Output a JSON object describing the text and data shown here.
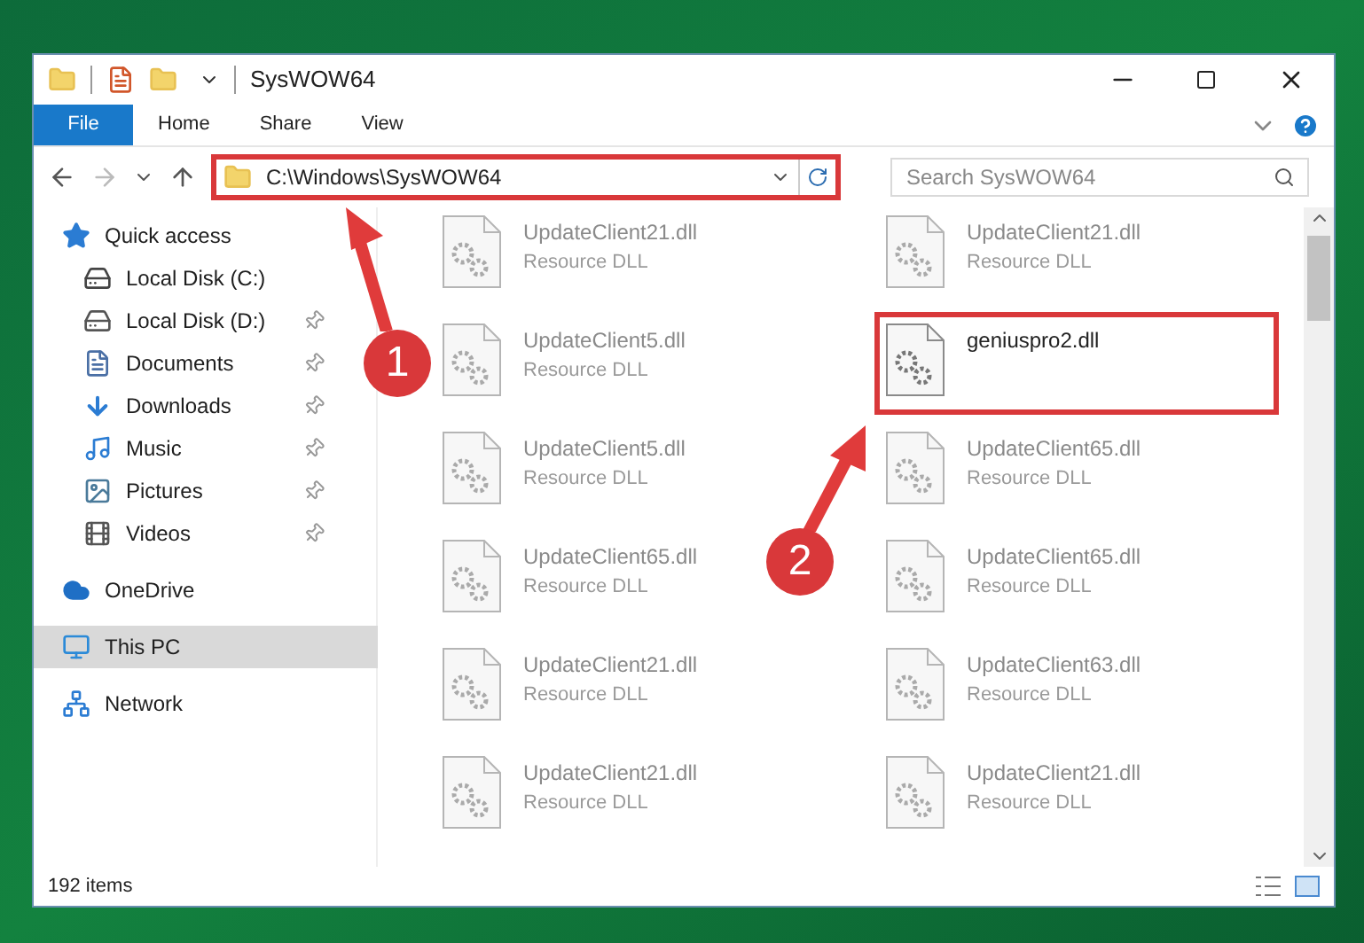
{
  "window": {
    "title": "SysWOW64"
  },
  "ribbon_tabs": [
    {
      "label": "File",
      "selected": true
    },
    {
      "label": "Home",
      "selected": false
    },
    {
      "label": "Share",
      "selected": false
    },
    {
      "label": "View",
      "selected": false
    }
  ],
  "address": {
    "path": "C:\\Windows\\SysWOW64",
    "highlighted": true
  },
  "search": {
    "placeholder": "Search SysWOW64"
  },
  "sidebar": {
    "items": [
      {
        "label": "Quick access",
        "kind": "quick",
        "selected": false,
        "pinned": false,
        "children": [
          {
            "label": "Local Disk (C:)",
            "kind": "disk-c",
            "selected": false,
            "pinned": false
          },
          {
            "label": "Local Disk (D:)",
            "kind": "disk",
            "selected": false,
            "pinned": true
          },
          {
            "label": "Documents",
            "kind": "documents",
            "selected": false,
            "pinned": true
          },
          {
            "label": "Downloads",
            "kind": "downloads",
            "selected": false,
            "pinned": true
          },
          {
            "label": "Music",
            "kind": "music",
            "selected": false,
            "pinned": true
          },
          {
            "label": "Pictures",
            "kind": "pictures",
            "selected": false,
            "pinned": true
          },
          {
            "label": "Videos",
            "kind": "videos",
            "selected": false,
            "pinned": true
          }
        ]
      },
      {
        "label": "OneDrive",
        "kind": "onedrive",
        "selected": false,
        "pinned": false
      },
      {
        "label": "This PC",
        "kind": "pc",
        "selected": true,
        "pinned": false
      },
      {
        "label": "Network",
        "kind": "network",
        "selected": false,
        "pinned": false
      }
    ]
  },
  "files": [
    {
      "name": "UpdateClient21.dll",
      "type": "Resource DLL",
      "dimmed": true,
      "highlighted": false
    },
    {
      "name": "UpdateClient21.dll",
      "type": "Resource DLL",
      "dimmed": true,
      "highlighted": false
    },
    {
      "name": "UpdateClient5.dll",
      "type": "Resource DLL",
      "dimmed": true,
      "highlighted": false
    },
    {
      "name": "geniuspro2.dll",
      "dimmed": false,
      "highlighted": true
    },
    {
      "name": "UpdateClient5.dll",
      "type": "Resource DLL",
      "dimmed": true,
      "highlighted": false
    },
    {
      "name": "UpdateClient65.dll",
      "type": "Resource DLL",
      "dimmed": true,
      "highlighted": false
    },
    {
      "name": "UpdateClient65.dll",
      "type": "Resource DLL",
      "dimmed": true,
      "highlighted": false
    },
    {
      "name": "UpdateClient65.dll",
      "type": "Resource DLL",
      "dimmed": true,
      "highlighted": false
    },
    {
      "name": "UpdateClient21.dll",
      "type": "Resource DLL",
      "dimmed": true,
      "highlighted": false
    },
    {
      "name": "UpdateClient63.dll",
      "type": "Resource DLL",
      "dimmed": true,
      "highlighted": false
    },
    {
      "name": "UpdateClient21.dll",
      "type": "Resource DLL",
      "dimmed": true,
      "highlighted": false
    },
    {
      "name": "UpdateClient21.dll",
      "type": "Resource DLL",
      "dimmed": true,
      "highlighted": false
    }
  ],
  "status_bar": {
    "item_count": "192 items"
  },
  "annotations": [
    {
      "label": "1"
    },
    {
      "label": "2"
    }
  ]
}
